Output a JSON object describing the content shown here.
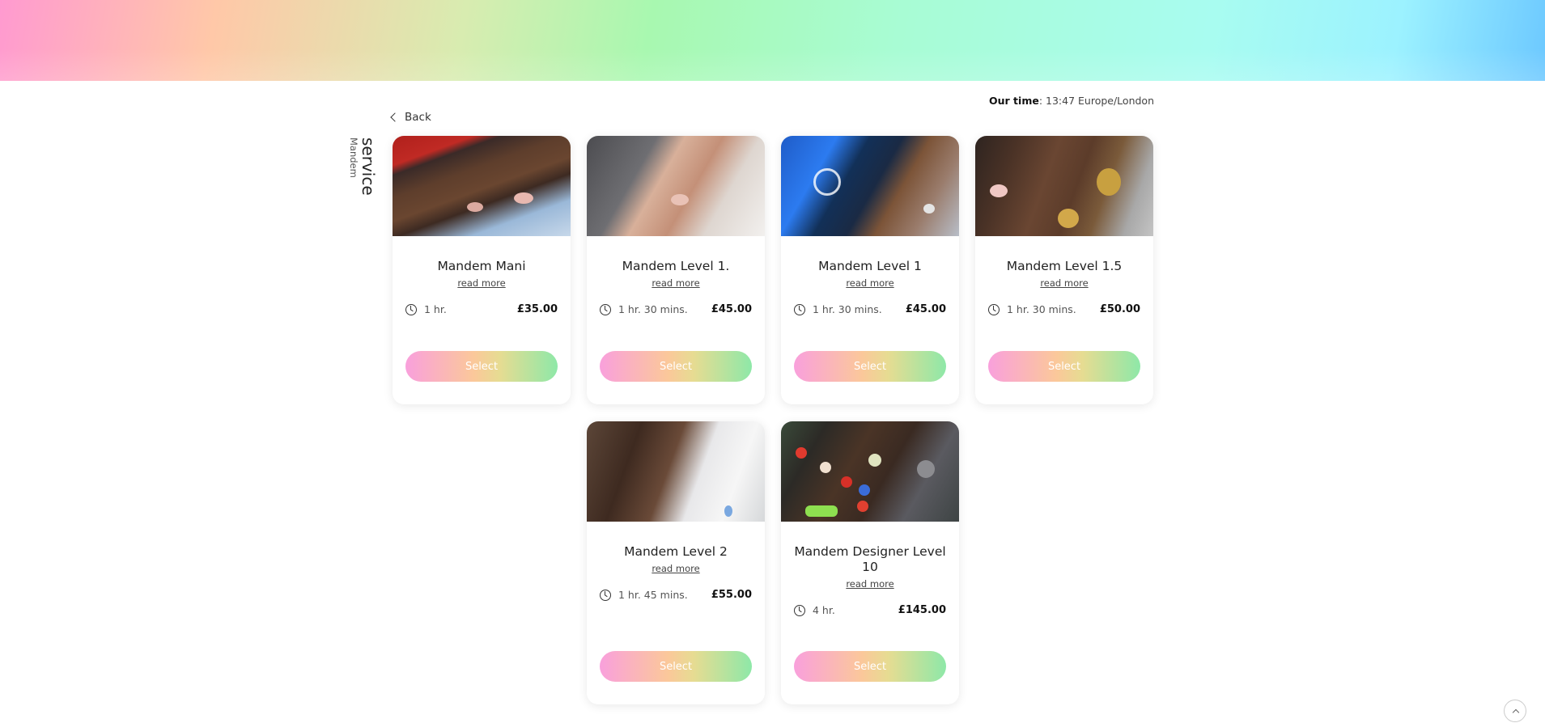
{
  "header": {
    "our_time_label": "Our time",
    "our_time_value": ": 13:47 Europe/London"
  },
  "nav": {
    "back_label": "Back"
  },
  "section": {
    "title": "service",
    "subtitle": "Mandem"
  },
  "services": [
    {
      "name": "Mandem Mani",
      "read_more": "read more",
      "duration": "1 hr.",
      "price": "£35.00",
      "select_label": "Select"
    },
    {
      "name": "Mandem Level 1.",
      "read_more": "read more",
      "duration": "1 hr. 30 mins.",
      "price": "£45.00",
      "select_label": "Select"
    },
    {
      "name": "Mandem Level 1",
      "read_more": "read more",
      "duration": "1 hr. 30 mins.",
      "price": "£45.00",
      "select_label": "Select"
    },
    {
      "name": "Mandem Level 1.5",
      "read_more": "read more",
      "duration": "1 hr. 30 mins.",
      "price": "£50.00",
      "select_label": "Select"
    },
    {
      "name": "Mandem Level 2",
      "read_more": "read more",
      "duration": "1 hr. 45 mins.",
      "price": "£55.00",
      "select_label": "Select"
    },
    {
      "name": "Mandem Designer Level 10",
      "read_more": "read more",
      "duration": "4 hr.",
      "price": "£145.00",
      "select_label": "Select"
    }
  ],
  "icons": {
    "back": "chevron-left-icon",
    "duration": "clock-icon",
    "scroll_top": "chevron-up-icon"
  },
  "colors": {
    "button_gradient": [
      "#f9a0dc",
      "#fbc89a",
      "#8ee8a8"
    ],
    "banner_gradient": [
      "#ff9ad0",
      "#a8f8b0",
      "#6cc8ff"
    ]
  }
}
